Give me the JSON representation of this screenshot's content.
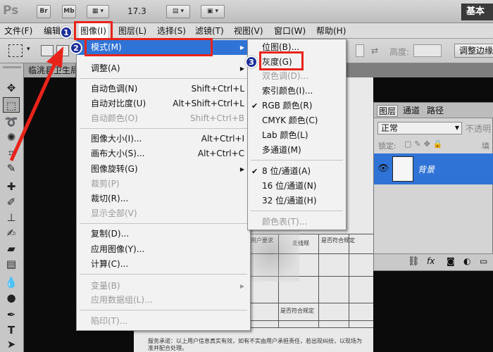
{
  "app": {
    "logo": "Ps",
    "bridge_btn": "Br",
    "mini_bridge_btn": "Mb",
    "zoom": "17.3",
    "workspace": "基本"
  },
  "menubar": [
    "文件(F)",
    "编辑",
    "图像(I)",
    "图层(L)",
    "选择(S)",
    "滤镜(T)",
    "视图(V)",
    "窗口(W)",
    "帮助(H)"
  ],
  "options": {
    "height_label": "高度:",
    "adjust_edge": "调整边缘"
  },
  "doc_tab": "临洮县卫生局..基本",
  "image_menu": {
    "items": [
      {
        "label": "模式(M)",
        "arrow": true,
        "highlight": true
      },
      {
        "label": "调整(A)",
        "arrow": true
      },
      {
        "label": "自动色调(N)",
        "shortcut": "Shift+Ctrl+L"
      },
      {
        "label": "自动对比度(U)",
        "shortcut": "Alt+Shift+Ctrl+L"
      },
      {
        "label": "自动颜色(O)",
        "shortcut": "Shift+Ctrl+B",
        "disabled": true
      },
      {
        "label": "图像大小(I)...",
        "shortcut": "Alt+Ctrl+I"
      },
      {
        "label": "画布大小(S)...",
        "shortcut": "Alt+Ctrl+C"
      },
      {
        "label": "图像旋转(G)",
        "arrow": true
      },
      {
        "label": "裁剪(P)",
        "disabled": true
      },
      {
        "label": "裁切(R)..."
      },
      {
        "label": "显示全部(V)",
        "disabled": true
      },
      {
        "label": "复制(D)..."
      },
      {
        "label": "应用图像(Y)..."
      },
      {
        "label": "计算(C)..."
      },
      {
        "label": "变量(B)",
        "arrow": true,
        "disabled": true
      },
      {
        "label": "应用数据组(L)...",
        "disabled": true
      },
      {
        "label": "陷印(T)...",
        "disabled": true
      }
    ]
  },
  "mode_menu": {
    "items": [
      {
        "label": "位图(B)..."
      },
      {
        "label": "灰度(G)"
      },
      {
        "label": "双色调(D)...",
        "disabled": true
      },
      {
        "label": "索引颜色(I)..."
      },
      {
        "label": "RGB 颜色(R)",
        "checked": true
      },
      {
        "label": "CMYK 颜色(C)"
      },
      {
        "label": "Lab 颜色(L)"
      },
      {
        "label": "多通道(M)"
      },
      {
        "label": "8 位/通道(A)",
        "checked": true
      },
      {
        "label": "16 位/通道(N)"
      },
      {
        "label": "32 位/通道(H)"
      },
      {
        "label": "颜色表(T)...",
        "disabled": true
      }
    ]
  },
  "layers_panel": {
    "tabs": [
      "图层",
      "通道",
      "路径"
    ],
    "blend_mode": "正常",
    "opacity_label": "不透明",
    "lock_label": "锁定:",
    "fill_label": "填",
    "layer_name": "背景"
  },
  "badges": [
    "1",
    "2",
    "3"
  ],
  "document_text": {
    "row1": "用户要求",
    "row2": "走线规",
    "row3": "是否符合规定",
    "row4": "是否符合规定",
    "footer": "服务承诺：以上用户信息真实有效，如有不实由用户承担责任，若出现纠纷，以现场为准并配合处理。"
  },
  "colors": {
    "accent_blue": "#2f73d6",
    "annotation_red": "#e8231a",
    "badge_blue": "#1d2f9a"
  }
}
